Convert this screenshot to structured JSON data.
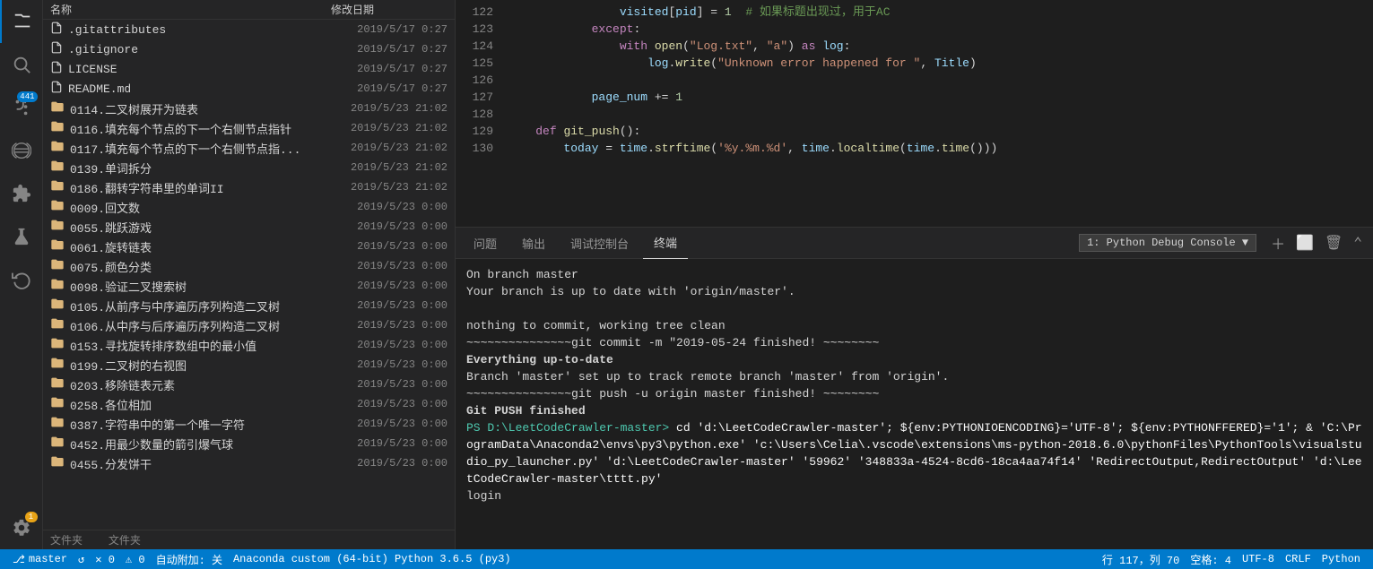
{
  "activityBar": {
    "icons": [
      {
        "name": "files-icon",
        "symbol": "⎘",
        "active": true,
        "badge": null
      },
      {
        "name": "search-icon",
        "symbol": "🔍",
        "active": false,
        "badge": null
      },
      {
        "name": "source-control-icon",
        "symbol": "⑂",
        "active": false,
        "badge": "441"
      },
      {
        "name": "debug-icon",
        "symbol": "⊘",
        "active": false,
        "badge": null
      },
      {
        "name": "extensions-icon",
        "symbol": "⊡",
        "active": false,
        "badge": null
      },
      {
        "name": "flask-icon",
        "symbol": "⚗",
        "active": false,
        "badge": null
      },
      {
        "name": "codicon-icon",
        "symbol": "↺",
        "active": false,
        "badge": null
      }
    ],
    "bottomIcons": [
      {
        "name": "settings-icon",
        "symbol": "⚙",
        "badge": "1"
      }
    ]
  },
  "filePanel": {
    "headers": {
      "name": "名称",
      "date": "修改日期"
    },
    "files": [
      {
        "name": ".gitattributes",
        "date": "2019/5/17 0:27",
        "type": "file"
      },
      {
        "name": ".gitignore",
        "date": "2019/5/17 0:27",
        "type": "file"
      },
      {
        "name": "LICENSE",
        "date": "2019/5/17 0:27",
        "type": "file"
      },
      {
        "name": "README.md",
        "date": "2019/5/17 0:27",
        "type": "file"
      },
      {
        "name": "0114.二叉树展开为链表",
        "date": "2019/5/23 21:02",
        "type": "folder"
      },
      {
        "name": "0116.填充每个节点的下一个右侧节点指针",
        "date": "2019/5/23 21:02",
        "type": "folder"
      },
      {
        "name": "0117.填充每个节点的下一个右侧节点指...",
        "date": "2019/5/23 21:02",
        "type": "folder"
      },
      {
        "name": "0139.单词拆分",
        "date": "2019/5/23 21:02",
        "type": "folder"
      },
      {
        "name": "0186.翻转字符串里的单词II",
        "date": "2019/5/23 21:02",
        "type": "folder"
      },
      {
        "name": "0009.回文数",
        "date": "2019/5/23 0:00",
        "type": "folder"
      },
      {
        "name": "0055.跳跃游戏",
        "date": "2019/5/23 0:00",
        "type": "folder"
      },
      {
        "name": "0061.旋转链表",
        "date": "2019/5/23 0:00",
        "type": "folder"
      },
      {
        "name": "0075.颜色分类",
        "date": "2019/5/23 0:00",
        "type": "folder"
      },
      {
        "name": "0098.验证二叉搜索树",
        "date": "2019/5/23 0:00",
        "type": "folder"
      },
      {
        "name": "0105.从前序与中序遍历序列构造二叉树",
        "date": "2019/5/23 0:00",
        "type": "folder"
      },
      {
        "name": "0106.从中序与后序遍历序列构造二叉树",
        "date": "2019/5/23 0:00",
        "type": "folder"
      },
      {
        "name": "0153.寻找旋转排序数组中的最小值",
        "date": "2019/5/23 0:00",
        "type": "folder"
      },
      {
        "name": "0199.二叉树的右视图",
        "date": "2019/5/23 0:00",
        "type": "folder"
      },
      {
        "name": "0203.移除链表元素",
        "date": "2019/5/23 0:00",
        "type": "folder"
      },
      {
        "name": "0258.各位相加",
        "date": "2019/5/23 0:00",
        "type": "folder"
      },
      {
        "name": "0387.字符串中的第一个唯一字符",
        "date": "2019/5/23 0:00",
        "type": "folder"
      },
      {
        "name": "0452.用最少数量的箭引爆气球",
        "date": "2019/5/23 0:00",
        "type": "folder"
      },
      {
        "name": "0455.分发饼干",
        "date": "2019/5/23 0:00",
        "type": "folder"
      }
    ]
  },
  "codeEditor": {
    "lines": [
      {
        "num": "122",
        "code": "                <span class='var'>visited</span><span class='op'>[</span><span class='var'>pid</span><span class='op'>]</span> <span class='op'>=</span> <span class='num'>1</span>  <span class='cm'># 如果标题出现过，用于AC</span>"
      },
      {
        "num": "123",
        "code": "            <span class='kw'>except</span><span class='op'>:</span>"
      },
      {
        "num": "124",
        "code": "                <span class='kw'>with</span> <span class='fn'>open</span><span class='op'>(</span><span class='str'>\"Log.txt\"</span><span class='op'>,</span> <span class='str'>\"a\"</span><span class='op'>)</span> <span class='kw'>as</span> <span class='var'>log</span><span class='op'>:</span>"
      },
      {
        "num": "125",
        "code": "                    <span class='var'>log</span><span class='op'>.</span><span class='fn'>write</span><span class='op'>(</span><span class='str'>\"Unknown error happened for \"</span><span class='op'>,</span> <span class='var'>Title</span><span class='op'>)</span>"
      },
      {
        "num": "126",
        "code": ""
      },
      {
        "num": "127",
        "code": "            <span class='var'>page_num</span> <span class='op'>+=</span> <span class='num'>1</span>"
      },
      {
        "num": "128",
        "code": ""
      },
      {
        "num": "129",
        "code": "    <span class='kw'>def</span> <span class='fn'>git_push</span><span class='op'>():</span>"
      },
      {
        "num": "130",
        "code": "        <span class='var'>today</span> <span class='op'>=</span> <span class='var'>time</span><span class='op'>.</span><span class='fn'>strftime</span><span class='op'>(</span><span class='str'>'%y.%m.%d'</span><span class='op'>,</span> <span class='var'>time</span><span class='op'>.</span><span class='fn'>localtime</span><span class='op'>(</span><span class='var'>time</span><span class='op'>.</span><span class='fn'>time</span><span class='op'>()))</span>"
      }
    ]
  },
  "panel": {
    "tabs": [
      {
        "label": "问题",
        "active": false
      },
      {
        "label": "输出",
        "active": false
      },
      {
        "label": "调试控制台",
        "active": false
      },
      {
        "label": "终端",
        "active": true
      }
    ],
    "terminalSelector": "1: Python Debug Console ▼",
    "terminalContent": [
      "On branch master",
      "Your branch is up to date with 'origin/master'.",
      "",
      "nothing to commit, working tree clean",
      "~~~~~~~~~~~~~~~git commit -m \"2019-05-24 finished! ~~~~~~~~",
      "Everything up-to-date",
      "Branch 'master' set up to track remote branch 'master' from 'origin'.",
      "~~~~~~~~~~~~~~~git push -u origin master finished! ~~~~~~~~",
      "Git PUSH finished",
      "PS D:\\LeetCodeCrawler-master> cd 'd:\\LeetCodeCrawler-master'; ${env:PYTHONIOENCODING}='UTF-8'; ${env:PYTHONFFERED}='1'; & 'C:\\ProgramData\\Anaconda2\\envs\\py3\\python.exe' 'c:\\Users\\Celia\\.vscode\\extensions\\ms-python-2018.6.0\\pythonFiles\\PythonTools\\visualstudio_py_launcher.py' 'd:\\LeetCodeCrawler-master' '59962' '348833a-4524-8cd6-18ca4aa74f14' 'RedirectOutput,RedirectOutput' 'd:\\LeetCodeCrawler-master\\tttt.py'",
      "login",
      ""
    ]
  },
  "statusBar": {
    "branch": "master",
    "sync": "↺",
    "errors": "✕ 0",
    "warnings": "⚠ 0",
    "autoAttach": "自动附加: 关",
    "interpreter": "Anaconda custom (64-bit) Python 3.6.5 (py3)",
    "line": "行 117，列 70",
    "spaces": "空格: 4",
    "encoding": "UTF-8",
    "lineending": "CRLF",
    "language": "Python"
  },
  "bottomLabels": {
    "label1": "文件夹",
    "label2": "文件夹"
  }
}
